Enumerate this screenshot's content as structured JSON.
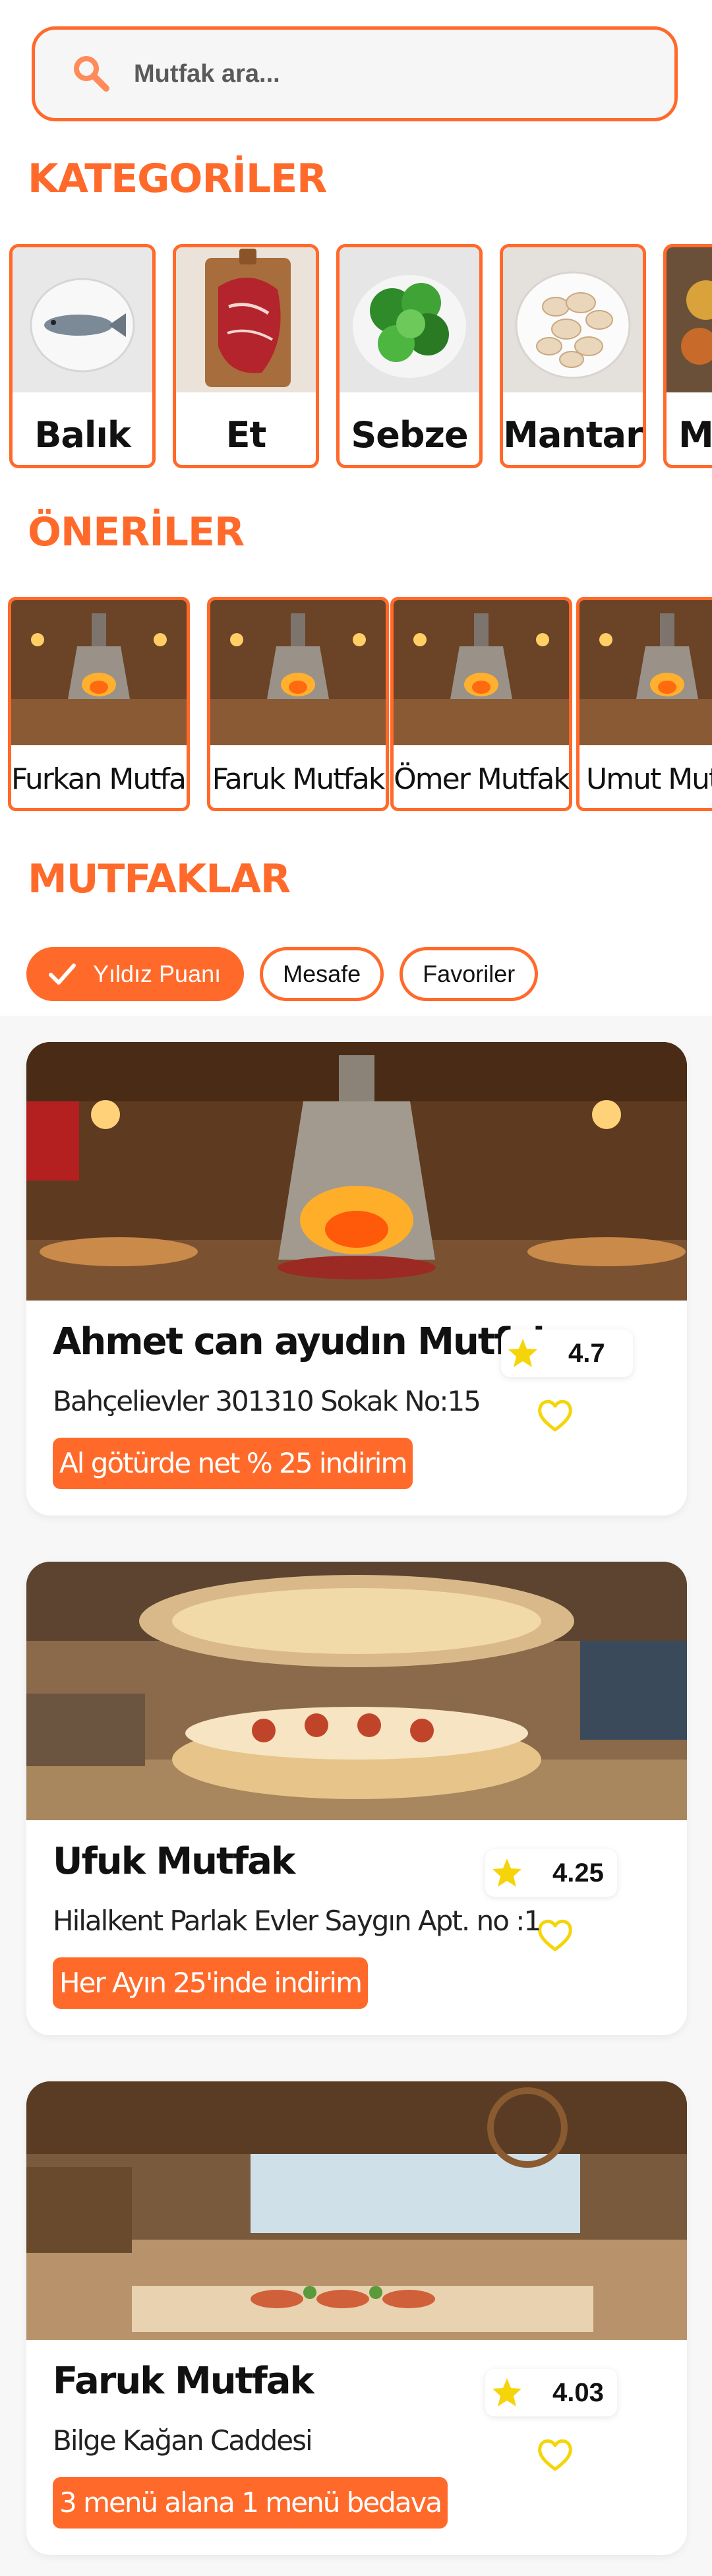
{
  "search": {
    "placeholder": "Mutfak ara...",
    "icon": "search-icon"
  },
  "sections": {
    "categories_title": "KATEGORİLER",
    "suggestions_title": "ÖNERİLER",
    "kitchens_title": "MUTFAKLAR"
  },
  "categories": [
    {
      "label": "Balık"
    },
    {
      "label": "Et"
    },
    {
      "label": "Sebze"
    },
    {
      "label": "Mantar"
    },
    {
      "label": "M"
    }
  ],
  "suggestions": [
    {
      "label": "Furkan Mutfak"
    },
    {
      "label": "Faruk Mutfak"
    },
    {
      "label": "Ömer Mutfak"
    },
    {
      "label": "Umut Mutfak"
    }
  ],
  "filters": [
    {
      "label": "Yıldız Puanı",
      "selected": true
    },
    {
      "label": "Mesafe",
      "selected": false
    },
    {
      "label": "Favoriler",
      "selected": false
    }
  ],
  "kitchens": [
    {
      "name": "Ahmet can ayudın  Mutfak",
      "address": "Bahçelievler 301310 Sokak No:15",
      "promo": "Al götürde net % 25  indirim",
      "rating": "4.7"
    },
    {
      "name": "Ufuk Mutfak",
      "address": "Hilalkent Parlak Evler Saygın Apt. no :1",
      "promo": "Her Ayın 25'inde indirim",
      "rating": "4.25"
    },
    {
      "name": "Faruk Mutfak",
      "address": "Bilge Kağan Caddesi",
      "promo": "3 menü alana 1 menü bedava",
      "rating": "4.03"
    }
  ],
  "colors": {
    "accent": "#ff6a2b",
    "star": "#f5d50a",
    "heart": "#f5d50a"
  }
}
